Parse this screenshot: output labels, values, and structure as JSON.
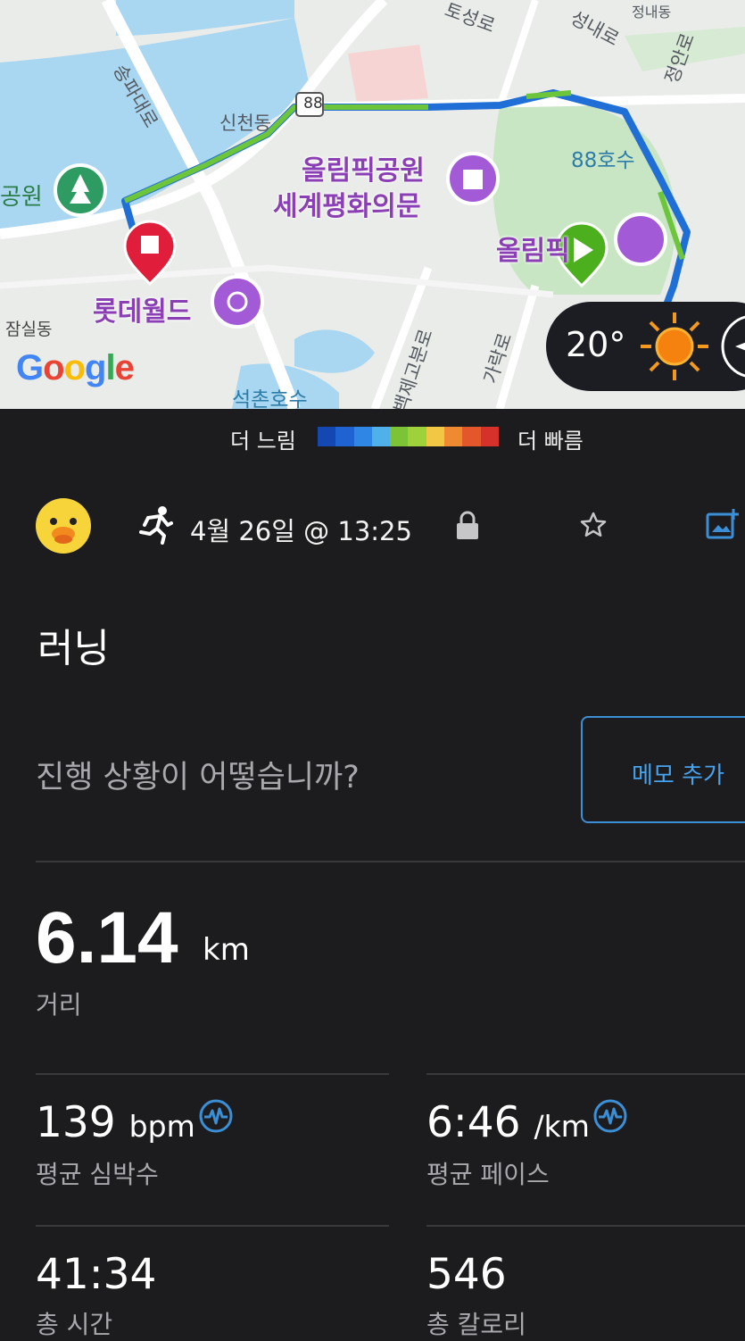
{
  "map": {
    "roads": {
      "songpadaero": "송파대로",
      "toseongro": "토성로",
      "seongnaero": "성내로",
      "jeongan": "정안로",
      "sincheondong": "신천동",
      "baekjegobunro": "백제고분로",
      "garakro": "가락로",
      "route_shield": "88"
    },
    "pois": {
      "olympic_park": "올림픽공원",
      "peace_gate": "세계평화의문",
      "lotte_world": "롯데월드",
      "olympic_partial": "올림픽",
      "park_left": "공원",
      "hosu_88": "88호수",
      "seokchon_lake": "석촌호수",
      "jamsil_dong": "잠실동",
      "top_right_cut": "정내동"
    },
    "attribution": "Google",
    "temperature": "20°",
    "colors": {
      "water": "#a9d6f1",
      "park": "#c8e6c4",
      "route_slow": "#1f6fd6",
      "route_fast": "#6cc53a",
      "start": "#4caf1d",
      "end": "#e11d3c"
    }
  },
  "legend": {
    "slower": "더 느림",
    "faster": "더 빠름",
    "colors": [
      "#1547b2",
      "#1e63d1",
      "#2f86e4",
      "#4fb0ea",
      "#7cc435",
      "#9fd23a",
      "#f2c744",
      "#f08a30",
      "#e3572b",
      "#d6312b"
    ]
  },
  "activity": {
    "datetime": "4월 26일 @ 13:25",
    "title": "러닝",
    "prompt": "진행 상황이 어떻습니까?",
    "memo_button": "메모 추가"
  },
  "stats": {
    "distance_value": "6.14",
    "distance_unit": "km",
    "distance_label": "거리",
    "hr_value": "139",
    "hr_unit": "bpm",
    "hr_label": "평균 심박수",
    "pace_value": "6:46",
    "pace_unit": "/km",
    "pace_label": "평균 페이스",
    "time_value": "41:34",
    "time_label": "총 시간",
    "cal_value": "546",
    "cal_label": "총 칼로리"
  }
}
